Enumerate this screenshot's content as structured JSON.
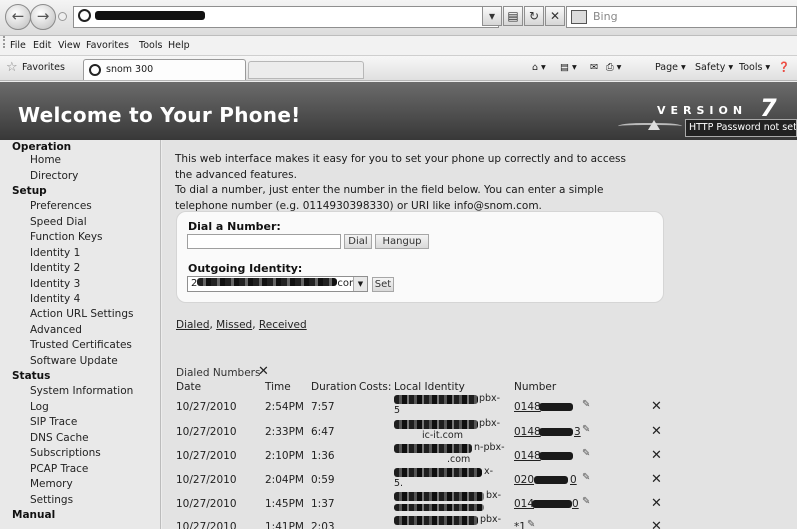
{
  "browser": {
    "search_placeholder": "Bing",
    "menu": [
      "File",
      "Edit",
      "View",
      "Favorites",
      "Tools",
      "Help"
    ],
    "favorites_label": "Favorites",
    "tab_title": "snom 300",
    "commands": [
      "Page",
      "Safety",
      "Tools"
    ]
  },
  "header": {
    "title": "Welcome to Your Phone!",
    "version_word": "VERSION",
    "version_number": "7",
    "password_warning": "HTTP Password not set"
  },
  "sidebar": {
    "operation": "Operation",
    "operation_items": [
      "Home",
      "Directory"
    ],
    "setup": "Setup",
    "setup_items": [
      "Preferences",
      "Speed Dial",
      "Function Keys",
      "Identity 1",
      "Identity 2",
      "Identity 3",
      "Identity 4",
      "Action URL Settings",
      "Advanced",
      "Trusted Certificates",
      "Software Update"
    ],
    "status": "Status",
    "status_items": [
      "System Information",
      "Log",
      "SIP Trace",
      "DNS Cache",
      "Subscriptions",
      "PCAP Trace",
      "Memory",
      "Settings"
    ],
    "manual": "Manual"
  },
  "main": {
    "intro_1": "This web interface makes it easy for you to set your phone up correctly and to access the advanced features.",
    "intro_2": "To dial a number, just enter the number in the field below. You can enter a simple telephone number (e.g. 0114930398330) or URI like info@snom.com.",
    "dial_label": "Dial a Number:",
    "dial_button": "Dial",
    "hangup_button": "Hangup",
    "identity_label": "Outgoing Identity:",
    "identity_prefix": "2",
    "identity_suffix": "com",
    "set_button": "Set",
    "link_dialed": "Dialed",
    "link_missed": "Missed",
    "link_received": "Received",
    "dialed_title": "Dialed Numbers",
    "columns": [
      "Date",
      "Time",
      "Duration",
      "Costs:",
      "Local Identity",
      "Number"
    ],
    "rows": [
      {
        "date": "10/27/2010",
        "time": "2:54PM",
        "duration": "7:57",
        "id_tail": "pbx-",
        "id_line2": "5",
        "number_prefix": "0148",
        "number_suffix": ""
      },
      {
        "date": "10/27/2010",
        "time": "2:33PM",
        "duration": "6:47",
        "id_tail": "pbx-",
        "id_line2": "ic-it.com",
        "number_prefix": "0148",
        "number_suffix": "3"
      },
      {
        "date": "10/27/2010",
        "time": "2:10PM",
        "duration": "1:36",
        "id_tail": "n-pbx-",
        "id_line2": ".com",
        "number_prefix": "0148",
        "number_suffix": ""
      },
      {
        "date": "10/27/2010",
        "time": "2:04PM",
        "duration": "0:59",
        "id_tail": "x-",
        "id_line2": "5.",
        "number_prefix": "020",
        "number_suffix": "0"
      },
      {
        "date": "10/27/2010",
        "time": "1:45PM",
        "duration": "1:37",
        "id_tail": "bx-",
        "id_line2": "",
        "number_prefix": "014",
        "number_suffix": "0"
      },
      {
        "date": "10/27/2010",
        "time": "1:41PM",
        "duration": "2:03",
        "id_tail": "pbx-",
        "id_line2": "",
        "number_prefix": "*1",
        "number_suffix": ""
      }
    ]
  }
}
